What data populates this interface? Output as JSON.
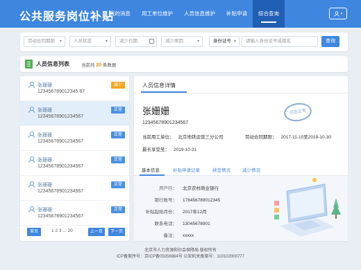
{
  "header": {
    "title": "公共服务岗位补贴",
    "nav": [
      "我的消息",
      "用工单位维护",
      "人员信息维护",
      "补贴申请",
      "综合查询"
    ],
    "active_nav": 4,
    "user_icon": "user-icon"
  },
  "filter": {
    "contract_period": "劳动合同期限",
    "person_status": "人员状态",
    "reduce_date": "减少日期",
    "reduce_reason": "减少原因",
    "id_type": "身份证号",
    "search_placeholder": "请输入身份证号或姓名",
    "search_label": "查询"
  },
  "list_header": {
    "title": "人员信息列表",
    "count_prefix": "当前共",
    "count": "20",
    "count_suffix": "条数据"
  },
  "people": [
    {
      "name": "张珊珊",
      "id": "123456789012345 67",
      "status": "减少"
    },
    {
      "name": "张珊珊",
      "id": "12345678901234567",
      "status": "正常"
    },
    {
      "name": "张珊珊",
      "id": "12345678901234567",
      "status": "正常"
    },
    {
      "name": "张珊珊",
      "id": "12345678901234567",
      "status": "正常"
    },
    {
      "name": "张珊珊",
      "id": "12345678901234567",
      "status": "正常"
    },
    {
      "name": "张珊珊",
      "id": "12345678901234567",
      "status": "正常"
    }
  ],
  "pager": {
    "first": "首页",
    "pages": "1 2 3 ... 20",
    "prev": "上一页",
    "next": "下一页"
  },
  "detail": {
    "section_title": "人员信息详情",
    "name": "张姗姗",
    "id": "12345678901234567",
    "employer_label": "当前用工单位：",
    "employer": "北京地铁运营三分公司",
    "contract_label": "劳动合同期限：",
    "contract": "2017-11-10至2019-10-30",
    "max_label": "最长享受至：",
    "max": "2019-10-31",
    "stamp": "状态正常",
    "tabs": [
      "基本信息",
      "补贴申请记录",
      "续签情况",
      "减少情况"
    ],
    "bank": [
      {
        "label": "开户行：",
        "value": "北京农村商业银行"
      },
      {
        "label": "银行账号：",
        "value": "178456789012345"
      },
      {
        "label": "补贴起始月份：",
        "value": "2017年12月"
      },
      {
        "label": "联系电话：",
        "value": "13045678901"
      },
      {
        "label": "备注：",
        "value": "xxxxx"
      }
    ]
  },
  "footer": {
    "line1": "北京市人力资源和社会保障局 版权所有",
    "line2": "ICP备案序号：京ICP备05056884号 公安机关备案号：110102000777"
  },
  "colors": {
    "primary": "#3e86e0",
    "badge_normal": "#4a90e2",
    "badge_reduced": "#f5a623"
  }
}
